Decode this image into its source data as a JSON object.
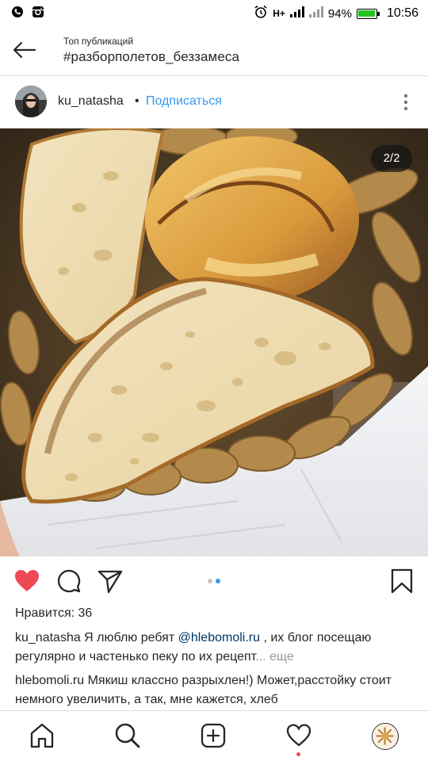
{
  "status_bar": {
    "battery": "94%",
    "battery_level": 0.94,
    "time": "10:56",
    "network": "H+",
    "icons": [
      "viber-icon",
      "instagram-icon",
      "alarm-icon",
      "signal-icon",
      "signal-icon-2",
      "battery-icon"
    ]
  },
  "header": {
    "subtitle": "Топ публикаций",
    "title": "#разборполетов_беззамеса"
  },
  "post": {
    "username": "ku_natasha",
    "separator": "•",
    "follow_label": "Подписаться",
    "counter": "2/2",
    "carousel_total": 2,
    "carousel_active": 2
  },
  "likes": "Нравится: 36",
  "caption": {
    "user": "ku_natasha",
    "text1": " Я люблю ребят ",
    "mention": "@hlebomoli.ru",
    "text2": " , их блог посещаю регулярно и частенько пеку по их рецепт",
    "ellipsis": "...",
    "more": "еще"
  },
  "comment": {
    "user": "hlebomoli.ru",
    "text": " Мякиш классно разрыхлен!) Может,расстойку стоит немного увеличить, а так, мне кажется, хлеб"
  },
  "colors": {
    "like_red": "#ed4956",
    "link_blue": "#3897f0",
    "mention_navy": "#003569",
    "battery_green": "#26c21f"
  }
}
